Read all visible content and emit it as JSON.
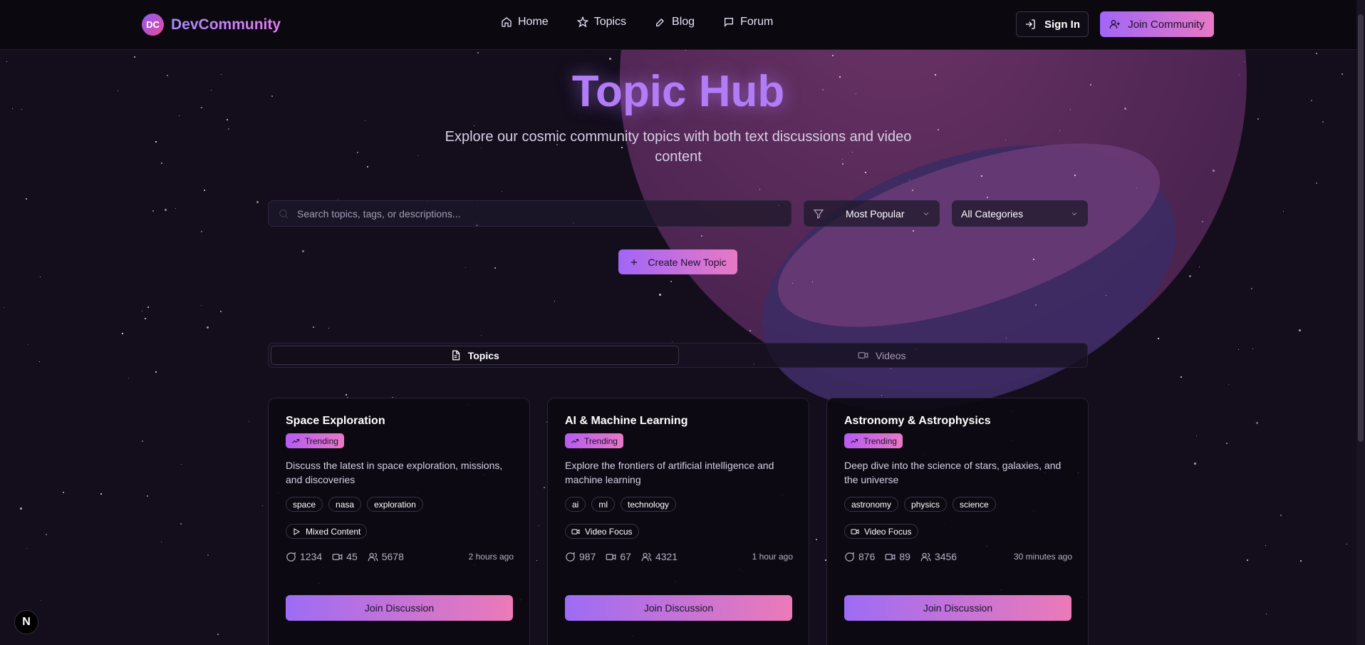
{
  "header": {
    "logo_initials": "DC",
    "app_name": "DevCommunity",
    "nav": [
      {
        "label": "Home",
        "icon": "home-icon"
      },
      {
        "label": "Topics",
        "icon": "star-icon"
      },
      {
        "label": "Blog",
        "icon": "edit-icon"
      },
      {
        "label": "Forum",
        "icon": "message-square-icon"
      }
    ],
    "sign_in_label": "Sign In",
    "join_label": "Join Community"
  },
  "hero": {
    "title": "Topic Hub",
    "subtitle": "Explore our cosmic community topics with both text discussions and video content"
  },
  "filters": {
    "search_placeholder": "Search topics, tags, or descriptions...",
    "sort_value": "Most Popular",
    "category_value": "All Categories"
  },
  "create_label": "Create New Topic",
  "tabs": [
    {
      "label": "Topics",
      "icon": "file-text-icon",
      "active": true
    },
    {
      "label": "Videos",
      "icon": "video-icon",
      "active": false
    }
  ],
  "cards": [
    {
      "title": "Space Exploration",
      "badge": "Trending",
      "description": "Discuss the latest in space exploration, missions, and discoveries",
      "tags": [
        "space",
        "nasa",
        "exploration"
      ],
      "content_type": "Mixed Content",
      "content_icon": "play-icon",
      "comments": "1234",
      "videos": "45",
      "members": "5678",
      "time": "2 hours ago",
      "button": "Join Discussion"
    },
    {
      "title": "AI & Machine Learning",
      "badge": "Trending",
      "description": "Explore the frontiers of artificial intelligence and machine learning",
      "tags": [
        "ai",
        "ml",
        "technology"
      ],
      "content_type": "Video Focus",
      "content_icon": "video-icon",
      "comments": "987",
      "videos": "67",
      "members": "4321",
      "time": "1 hour ago",
      "button": "Join Discussion"
    },
    {
      "title": "Astronomy & Astrophysics",
      "badge": "Trending",
      "description": "Deep dive into the science of stars, galaxies, and the universe",
      "tags": [
        "astronomy",
        "physics",
        "science"
      ],
      "content_type": "Video Focus",
      "content_icon": "video-icon",
      "comments": "876",
      "videos": "89",
      "members": "3456",
      "time": "30 minutes ago",
      "button": "Join Discussion"
    }
  ],
  "dev_badge": "N",
  "colors": {
    "accent_start": "#a166f7",
    "accent_end": "#e879c5",
    "background": "#130d1c"
  }
}
